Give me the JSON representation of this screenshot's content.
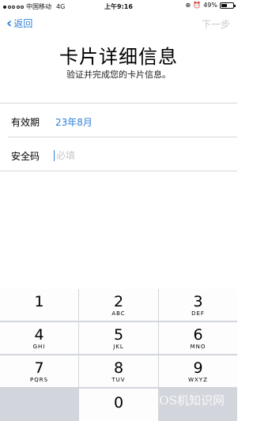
{
  "status_bar": {
    "carrier": "中国移动",
    "network": "4G",
    "time": "上午9:16",
    "battery": "49%"
  },
  "nav": {
    "back_label": "返回",
    "next_label": "下一步"
  },
  "header": {
    "title": "卡片详细信息",
    "subtitle": "验证并完成您的卡片信息。"
  },
  "form": {
    "expiry_label": "有效期",
    "expiry_value": "23年8月",
    "cvv_label": "安全码",
    "cvv_placeholder": "必填"
  },
  "keypad": {
    "keys": [
      {
        "num": "1",
        "letters": ""
      },
      {
        "num": "2",
        "letters": "ABC"
      },
      {
        "num": "3",
        "letters": "DEF"
      },
      {
        "num": "4",
        "letters": "GHI"
      },
      {
        "num": "5",
        "letters": "JKL"
      },
      {
        "num": "6",
        "letters": "MNO"
      },
      {
        "num": "7",
        "letters": "PQRS"
      },
      {
        "num": "8",
        "letters": "TUV"
      },
      {
        "num": "9",
        "letters": "WXYZ"
      },
      {
        "num": "0",
        "letters": ""
      }
    ]
  },
  "watermark": "OS机知识网",
  "colors": {
    "accent": "#2d7fd8",
    "disabled": "#c8c8c8",
    "keypad_bg": "#d2d5db"
  }
}
